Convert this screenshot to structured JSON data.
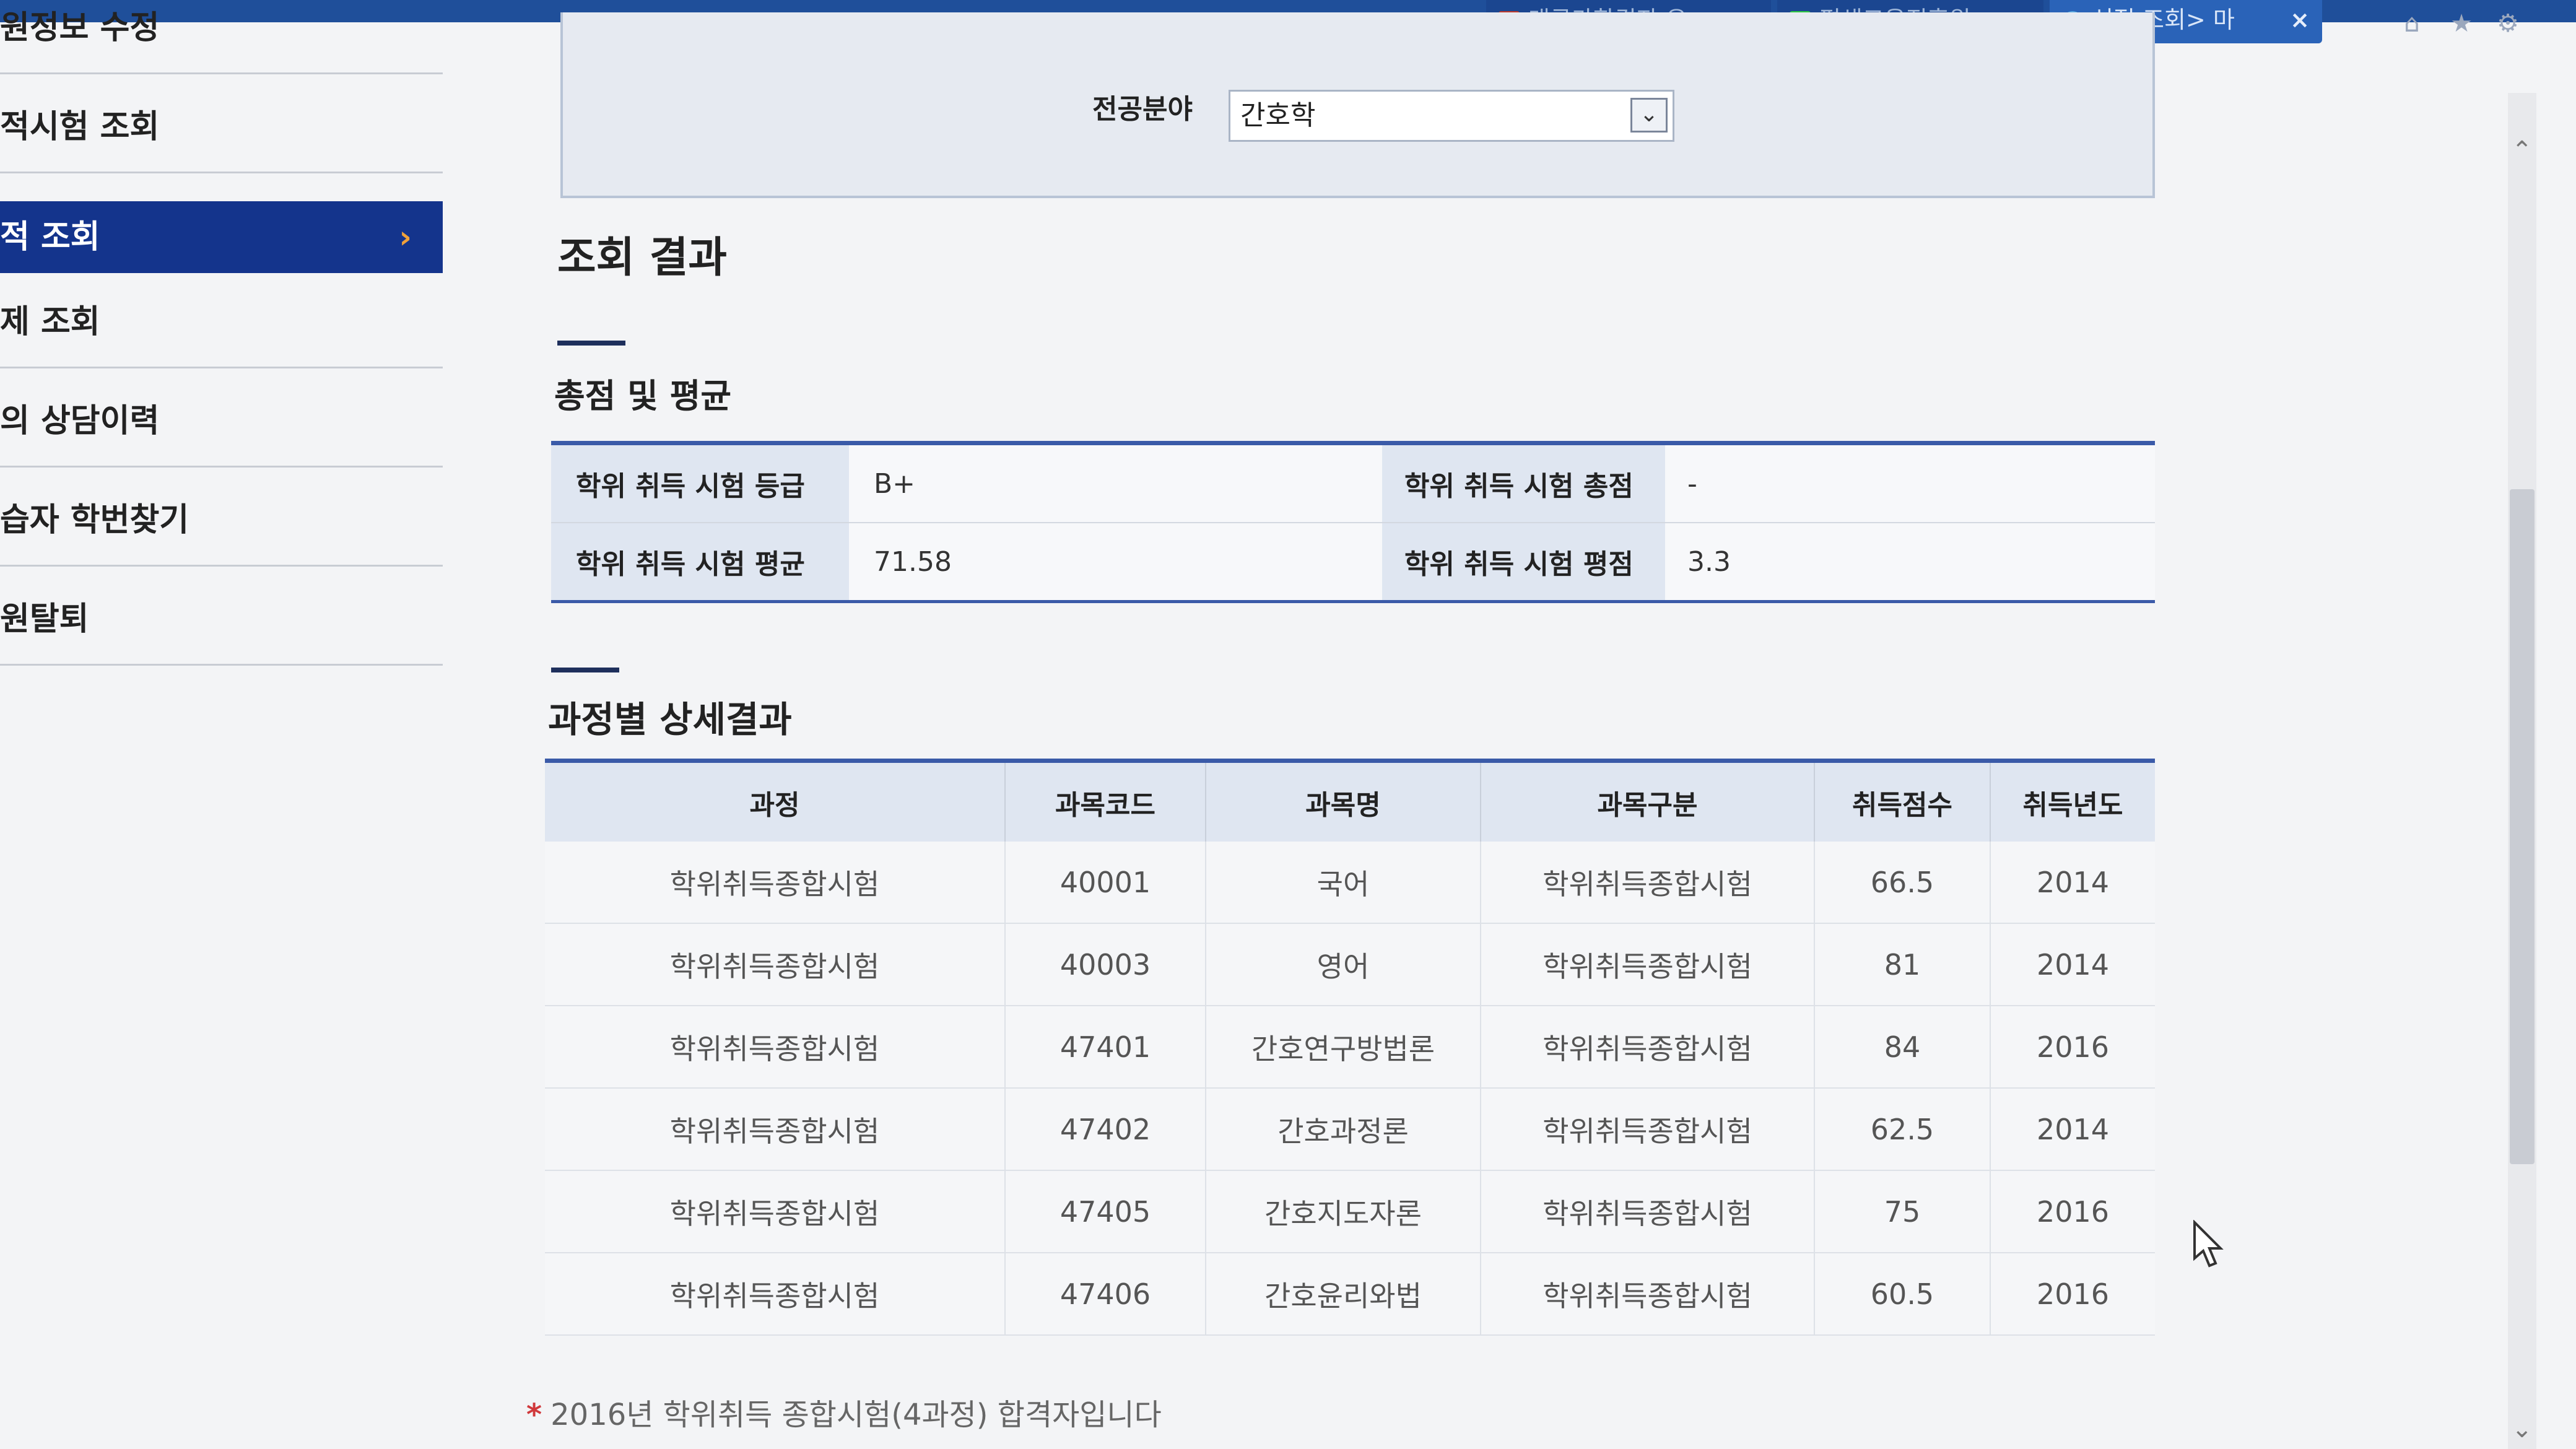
{
  "browser": {
    "tabs": [
      {
        "label": "대국가합격자 유"
      },
      {
        "label": "평생교육진흥원 -"
      },
      {
        "label": "성적 조회> 마",
        "close": "×"
      }
    ],
    "toolbar_icons": [
      "home-icon",
      "star-icon",
      "gear-icon"
    ]
  },
  "sidebar": {
    "items": [
      {
        "label": "원정보 수정"
      },
      {
        "label": "적시험 조회"
      },
      {
        "label": "적 조회",
        "arrow": "›"
      },
      {
        "label": "제 조회"
      },
      {
        "label": "의 상담이력"
      },
      {
        "label": "습자 학번찾기"
      },
      {
        "label": "원탈퇴"
      }
    ]
  },
  "filter": {
    "label": "전공분야",
    "selected": "간호학"
  },
  "result_heading": "조회 결과",
  "summary": {
    "heading": "총점 및 평균",
    "rows": [
      {
        "label1": "학위 취득 시험 등급",
        "value1": "B+",
        "label2": "학위 취득 시험 총점",
        "value2": "-"
      },
      {
        "label1": "학위 취득 시험 평균",
        "value1": "71.58",
        "label2": "학위 취득 시험 평점",
        "value2": "3.3"
      }
    ]
  },
  "detail": {
    "heading": "과정별 상세결과",
    "columns": [
      "과정",
      "과목코드",
      "과목명",
      "과목구분",
      "취득점수",
      "취득년도"
    ],
    "rows": [
      [
        "학위취득종합시험",
        "40001",
        "국어",
        "학위취득종합시험",
        "66.5",
        "2014"
      ],
      [
        "학위취득종합시험",
        "40003",
        "영어",
        "학위취득종합시험",
        "81",
        "2014"
      ],
      [
        "학위취득종합시험",
        "47401",
        "간호연구방법론",
        "학위취득종합시험",
        "84",
        "2016"
      ],
      [
        "학위취득종합시험",
        "47402",
        "간호과정론",
        "학위취득종합시험",
        "62.5",
        "2014"
      ],
      [
        "학위취득종합시험",
        "47405",
        "간호지도자론",
        "학위취득종합시험",
        "75",
        "2016"
      ],
      [
        "학위취득종합시험",
        "47406",
        "간호윤리와법",
        "학위취득종합시험",
        "60.5",
        "2016"
      ]
    ]
  },
  "note": {
    "star": "*",
    "text": "2016년 학위취득 종합시험(4과정) 합격자입니다"
  },
  "colors": {
    "accent": "#14348c",
    "table_border": "#3a5aa8",
    "header_bg": "#dfe6f1"
  }
}
